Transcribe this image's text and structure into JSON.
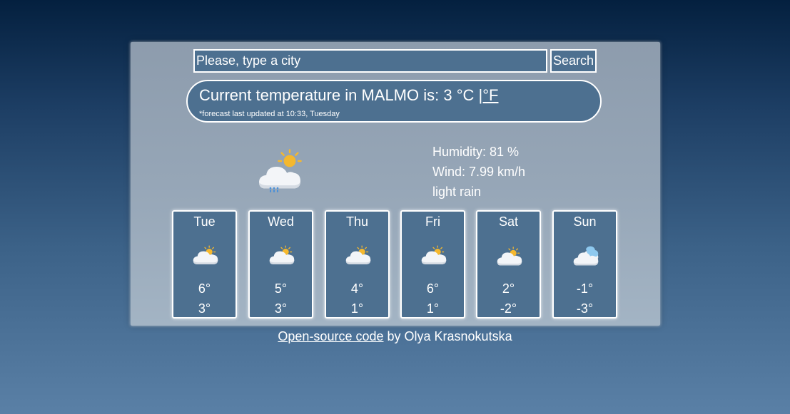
{
  "search": {
    "placeholder": "Please, type a city",
    "button_label": "Search"
  },
  "current": {
    "prefix": "Current temperature in ",
    "city": "MALMO",
    "middle": " is: ",
    "temperature": "3",
    "unit_celsius": " °C ",
    "unit_fahrenheit": "|°F",
    "updated": "*forecast last updated at 10:33, Tuesday",
    "icon": "cloud-sun-rain-icon"
  },
  "details": {
    "humidity": "Humidity: 81 %",
    "wind": "Wind: 7.99 km/h",
    "description": "light rain"
  },
  "forecast": [
    {
      "day": "Tue",
      "max": "6°",
      "min": "3°",
      "icon": "cloud-sun-icon"
    },
    {
      "day": "Wed",
      "max": "5°",
      "min": "3°",
      "icon": "cloud-sun-icon"
    },
    {
      "day": "Thu",
      "max": "4°",
      "min": "1°",
      "icon": "cloud-sun-icon"
    },
    {
      "day": "Fri",
      "max": "6°",
      "min": "1°",
      "icon": "cloud-sun-icon"
    },
    {
      "day": "Sat",
      "max": "2°",
      "min": "-2°",
      "icon": "cloud-sun-icon"
    },
    {
      "day": "Sun",
      "max": "-1°",
      "min": "-3°",
      "icon": "cloud-snow-icon"
    }
  ],
  "footer": {
    "link_label": "Open-source code",
    "suffix": " by Olya Krasnokutska"
  },
  "colors": {
    "panel_blue": "#4d7090",
    "sun": "#f5b82e",
    "cloud": "#ffffff"
  }
}
